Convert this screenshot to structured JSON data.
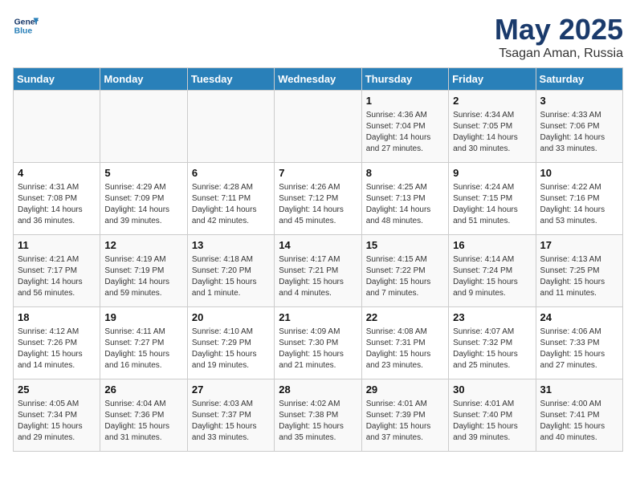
{
  "header": {
    "logo_line1": "General",
    "logo_line2": "Blue",
    "month": "May 2025",
    "location": "Tsagan Aman, Russia"
  },
  "weekdays": [
    "Sunday",
    "Monday",
    "Tuesday",
    "Wednesday",
    "Thursday",
    "Friday",
    "Saturday"
  ],
  "weeks": [
    [
      {
        "day": "",
        "info": ""
      },
      {
        "day": "",
        "info": ""
      },
      {
        "day": "",
        "info": ""
      },
      {
        "day": "",
        "info": ""
      },
      {
        "day": "1",
        "info": "Sunrise: 4:36 AM\nSunset: 7:04 PM\nDaylight: 14 hours\nand 27 minutes."
      },
      {
        "day": "2",
        "info": "Sunrise: 4:34 AM\nSunset: 7:05 PM\nDaylight: 14 hours\nand 30 minutes."
      },
      {
        "day": "3",
        "info": "Sunrise: 4:33 AM\nSunset: 7:06 PM\nDaylight: 14 hours\nand 33 minutes."
      }
    ],
    [
      {
        "day": "4",
        "info": "Sunrise: 4:31 AM\nSunset: 7:08 PM\nDaylight: 14 hours\nand 36 minutes."
      },
      {
        "day": "5",
        "info": "Sunrise: 4:29 AM\nSunset: 7:09 PM\nDaylight: 14 hours\nand 39 minutes."
      },
      {
        "day": "6",
        "info": "Sunrise: 4:28 AM\nSunset: 7:11 PM\nDaylight: 14 hours\nand 42 minutes."
      },
      {
        "day": "7",
        "info": "Sunrise: 4:26 AM\nSunset: 7:12 PM\nDaylight: 14 hours\nand 45 minutes."
      },
      {
        "day": "8",
        "info": "Sunrise: 4:25 AM\nSunset: 7:13 PM\nDaylight: 14 hours\nand 48 minutes."
      },
      {
        "day": "9",
        "info": "Sunrise: 4:24 AM\nSunset: 7:15 PM\nDaylight: 14 hours\nand 51 minutes."
      },
      {
        "day": "10",
        "info": "Sunrise: 4:22 AM\nSunset: 7:16 PM\nDaylight: 14 hours\nand 53 minutes."
      }
    ],
    [
      {
        "day": "11",
        "info": "Sunrise: 4:21 AM\nSunset: 7:17 PM\nDaylight: 14 hours\nand 56 minutes."
      },
      {
        "day": "12",
        "info": "Sunrise: 4:19 AM\nSunset: 7:19 PM\nDaylight: 14 hours\nand 59 minutes."
      },
      {
        "day": "13",
        "info": "Sunrise: 4:18 AM\nSunset: 7:20 PM\nDaylight: 15 hours\nand 1 minute."
      },
      {
        "day": "14",
        "info": "Sunrise: 4:17 AM\nSunset: 7:21 PM\nDaylight: 15 hours\nand 4 minutes."
      },
      {
        "day": "15",
        "info": "Sunrise: 4:15 AM\nSunset: 7:22 PM\nDaylight: 15 hours\nand 7 minutes."
      },
      {
        "day": "16",
        "info": "Sunrise: 4:14 AM\nSunset: 7:24 PM\nDaylight: 15 hours\nand 9 minutes."
      },
      {
        "day": "17",
        "info": "Sunrise: 4:13 AM\nSunset: 7:25 PM\nDaylight: 15 hours\nand 11 minutes."
      }
    ],
    [
      {
        "day": "18",
        "info": "Sunrise: 4:12 AM\nSunset: 7:26 PM\nDaylight: 15 hours\nand 14 minutes."
      },
      {
        "day": "19",
        "info": "Sunrise: 4:11 AM\nSunset: 7:27 PM\nDaylight: 15 hours\nand 16 minutes."
      },
      {
        "day": "20",
        "info": "Sunrise: 4:10 AM\nSunset: 7:29 PM\nDaylight: 15 hours\nand 19 minutes."
      },
      {
        "day": "21",
        "info": "Sunrise: 4:09 AM\nSunset: 7:30 PM\nDaylight: 15 hours\nand 21 minutes."
      },
      {
        "day": "22",
        "info": "Sunrise: 4:08 AM\nSunset: 7:31 PM\nDaylight: 15 hours\nand 23 minutes."
      },
      {
        "day": "23",
        "info": "Sunrise: 4:07 AM\nSunset: 7:32 PM\nDaylight: 15 hours\nand 25 minutes."
      },
      {
        "day": "24",
        "info": "Sunrise: 4:06 AM\nSunset: 7:33 PM\nDaylight: 15 hours\nand 27 minutes."
      }
    ],
    [
      {
        "day": "25",
        "info": "Sunrise: 4:05 AM\nSunset: 7:34 PM\nDaylight: 15 hours\nand 29 minutes."
      },
      {
        "day": "26",
        "info": "Sunrise: 4:04 AM\nSunset: 7:36 PM\nDaylight: 15 hours\nand 31 minutes."
      },
      {
        "day": "27",
        "info": "Sunrise: 4:03 AM\nSunset: 7:37 PM\nDaylight: 15 hours\nand 33 minutes."
      },
      {
        "day": "28",
        "info": "Sunrise: 4:02 AM\nSunset: 7:38 PM\nDaylight: 15 hours\nand 35 minutes."
      },
      {
        "day": "29",
        "info": "Sunrise: 4:01 AM\nSunset: 7:39 PM\nDaylight: 15 hours\nand 37 minutes."
      },
      {
        "day": "30",
        "info": "Sunrise: 4:01 AM\nSunset: 7:40 PM\nDaylight: 15 hours\nand 39 minutes."
      },
      {
        "day": "31",
        "info": "Sunrise: 4:00 AM\nSunset: 7:41 PM\nDaylight: 15 hours\nand 40 minutes."
      }
    ]
  ]
}
